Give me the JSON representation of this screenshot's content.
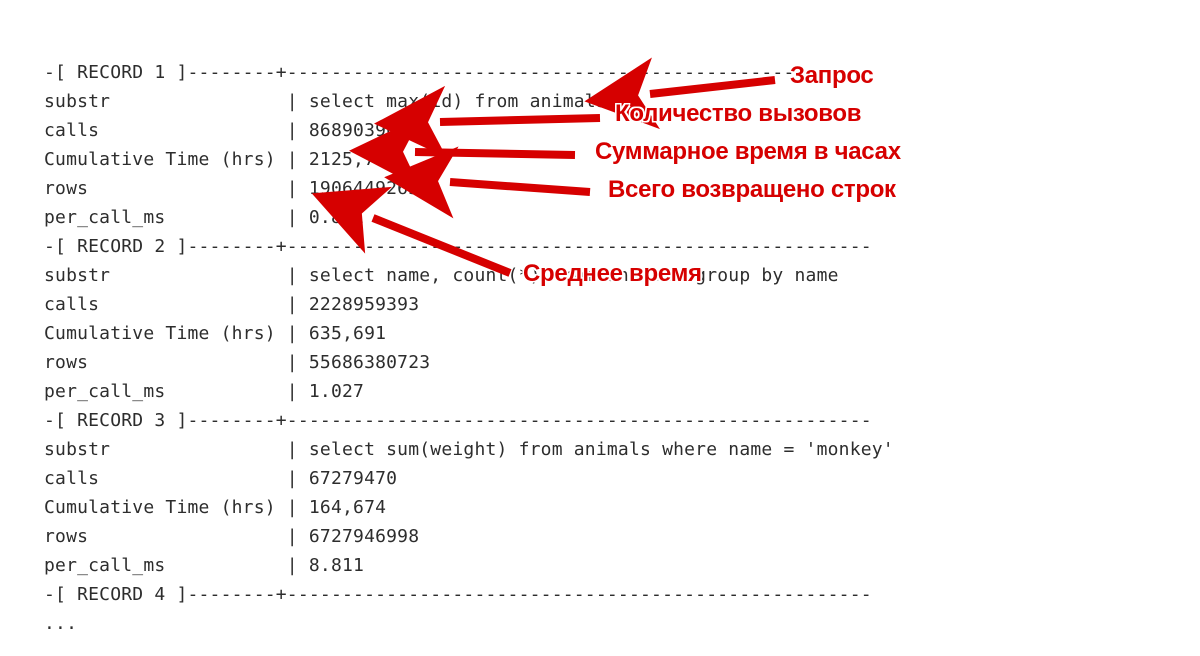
{
  "separator_dash_full": "-[ RECORD {N} ]--------+-----------------------------------------------------",
  "ellipsis": "...",
  "fields": [
    "substr",
    "calls",
    "Cumulative Time (hrs)",
    "rows",
    "per_call_ms"
  ],
  "records": [
    {
      "header": "-[ RECORD 1 ]--------+-----------------------------------------------------",
      "rows": [
        {
          "label": "substr               ",
          "value": "select max(id) from animals"
        },
        {
          "label": "calls                ",
          "value": "8689039087"
        },
        {
          "label": "Cumulative Time (hrs)",
          "value": "2125,701"
        },
        {
          "label": "rows                 ",
          "value": "19064492638"
        },
        {
          "label": "per_call_ms          ",
          "value": "0.881"
        }
      ]
    },
    {
      "header": "-[ RECORD 2 ]--------+-----------------------------------------------------",
      "rows": [
        {
          "label": "substr               ",
          "value": "select name, count(*) from animals group by name"
        },
        {
          "label": "calls                ",
          "value": "2228959393"
        },
        {
          "label": "Cumulative Time (hrs)",
          "value": "635,691"
        },
        {
          "label": "rows                 ",
          "value": "55686380723"
        },
        {
          "label": "per_call_ms          ",
          "value": "1.027"
        }
      ]
    },
    {
      "header": "-[ RECORD 3 ]--------+-----------------------------------------------------",
      "rows": [
        {
          "label": "substr               ",
          "value": "select sum(weight) from animals where name = 'monkey'"
        },
        {
          "label": "calls                ",
          "value": "67279470"
        },
        {
          "label": "Cumulative Time (hrs)",
          "value": "164,674"
        },
        {
          "label": "rows                 ",
          "value": "6727946998"
        },
        {
          "label": "per_call_ms          ",
          "value": "8.811"
        }
      ]
    }
  ],
  "record4_header": "-[ RECORD 4 ]--------+-----------------------------------------------------",
  "annotations": [
    {
      "key": "query",
      "text": "Запрос"
    },
    {
      "key": "calls",
      "text": "Количество вызовов"
    },
    {
      "key": "cumtime",
      "text": "Суммарное время в часах"
    },
    {
      "key": "rows",
      "text": "Всего возвращено строк"
    },
    {
      "key": "percall",
      "text": "Среднее время"
    }
  ]
}
